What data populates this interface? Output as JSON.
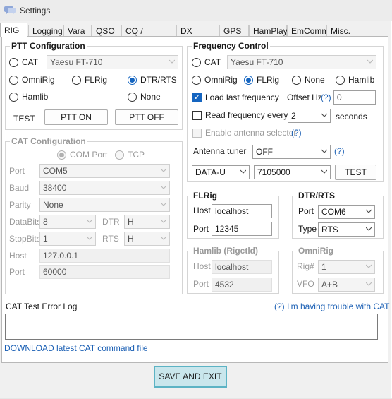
{
  "window": {
    "title": "Settings"
  },
  "tabs": [
    {
      "label": "RIG",
      "active": true
    },
    {
      "label": "Logging"
    },
    {
      "label": "Vara"
    },
    {
      "label": "QSO"
    },
    {
      "label": "CQ / Beacon"
    },
    {
      "label": "DX Cluster"
    },
    {
      "label": "GPS"
    },
    {
      "label": "HamPlay"
    },
    {
      "label": "EmComm"
    },
    {
      "label": "Misc."
    }
  ],
  "ptt": {
    "title": "PTT Configuration",
    "cat_label": "CAT",
    "cat_rig": "Yaesu FT-710",
    "omnirig": "OmniRig",
    "flrig": "FLRig",
    "dtr_rts": "DTR/RTS",
    "hamlib": "Hamlib",
    "none": "None",
    "test_label": "TEST",
    "ptt_on": "PTT ON",
    "ptt_off": "PTT OFF"
  },
  "cat": {
    "title": "CAT Configuration",
    "com_port": "COM Port",
    "tcp": "TCP",
    "port_label": "Port",
    "port_value": "COM5",
    "baud_label": "Baud",
    "baud_value": "38400",
    "parity_label": "Parity",
    "parity_value": "None",
    "databits_label": "DataBits",
    "databits_value": "8",
    "dtr_label": "DTR",
    "dtr_value": "H",
    "stopbits_label": "StopBits",
    "stopbits_value": "1",
    "rts_label": "RTS",
    "rts_value": "H",
    "host_label": "Host",
    "host_value": "127.0.0.1",
    "tcp_port_label": "Port",
    "tcp_port_value": "60000"
  },
  "freq": {
    "title": "Frequency Control",
    "cat_label": "CAT",
    "cat_rig": "Yaesu FT-710",
    "omnirig": "OmniRig",
    "flrig": "FLRig",
    "none": "None",
    "hamlib": "Hamlib",
    "load_last": "Load last frequency",
    "offset_label": "Offset Hz",
    "help": "(?)",
    "offset_value": "0",
    "read_every": "Read frequency every",
    "read_value": "2",
    "seconds": "seconds",
    "enable_antenna": "Enable antenna selector",
    "antenna_tuner": "Antenna tuner",
    "antenna_value": "OFF",
    "mode_value": "DATA-U",
    "freq_value": "7105000",
    "test_label": "TEST"
  },
  "flrig": {
    "title": "FLRig",
    "host_label": "Host",
    "host_value": "localhost",
    "port_label": "Port",
    "port_value": "12345"
  },
  "dtrrts": {
    "title": "DTR/RTS",
    "port_label": "Port",
    "port_value": "COM6",
    "type_label": "Type",
    "type_value": "RTS"
  },
  "hamlib": {
    "title": "Hamlib (Rigctld)",
    "host_label": "Host",
    "host_value": "localhost",
    "port_label": "Port",
    "port_value": "4532"
  },
  "omnirig": {
    "title": "OmniRig",
    "rig_label": "Rig#",
    "rig_value": "1",
    "vfo_label": "VFO",
    "vfo_value": "A+B"
  },
  "log": {
    "title": "CAT Test Error Log",
    "trouble": "(?) I'm having trouble with CAT",
    "download": "DOWNLOAD latest CAT command file"
  },
  "footer": {
    "save_exit": "SAVE AND EXIT"
  },
  "colors": {
    "accent": "#1565c0",
    "link": "#1a5fb4",
    "save_bg": "#c9e6ec",
    "save_border": "#5cb3c4"
  }
}
